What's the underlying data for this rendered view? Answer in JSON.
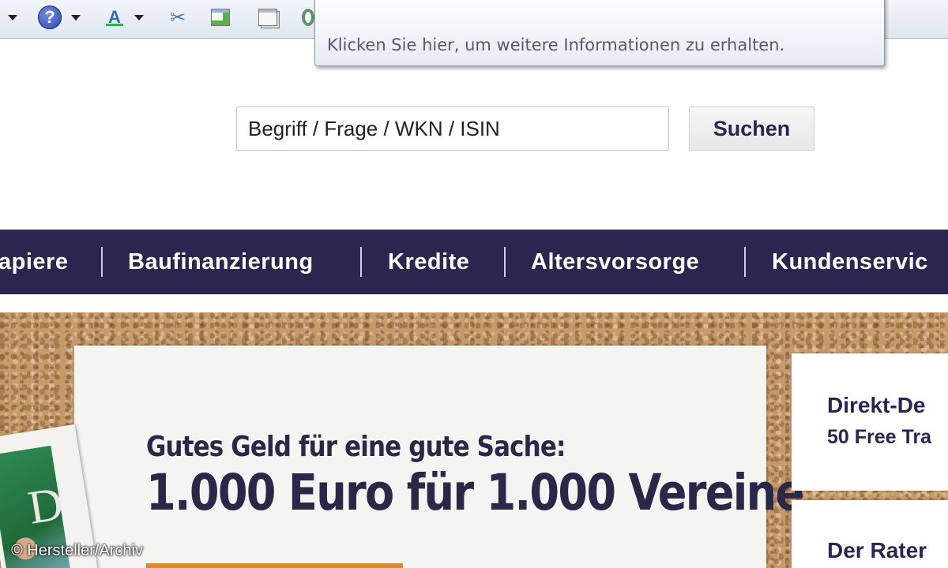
{
  "toolbar": {
    "icons": [
      "dropdown-arrow-icon",
      "help-icon",
      "font-size-icon",
      "tools-icon",
      "new-window-icon",
      "print-icon",
      "globe-icon"
    ],
    "help_glyph": "?",
    "font_glyph": "A",
    "tools_glyph": "✂"
  },
  "tooltip": {
    "text": "Klicken Sie hier, um weitere Informationen zu erhalten."
  },
  "search": {
    "placeholder": "Begriff / Frage / WKN / ISIN",
    "button_label": "Suchen"
  },
  "nav": {
    "items": [
      "apiere",
      "Baufinanzierung",
      "Kredite",
      "Altersvorsorge",
      "Kundenservic"
    ]
  },
  "promo": {
    "subtitle": "Gutes Geld für eine gute Sache:",
    "title": "1.000 Euro für 1.000 Vereine",
    "photo_letter": "D"
  },
  "side_cards": [
    {
      "title": "Direkt-De",
      "text": "50 Free Tra"
    },
    {
      "title": "Der Rater",
      "text": ""
    }
  ],
  "credit": "© Hersteller/Archiv",
  "colors": {
    "nav_background": "#2b2550",
    "brand_text": "#2a2550",
    "accent_orange": "#d98a2b"
  }
}
